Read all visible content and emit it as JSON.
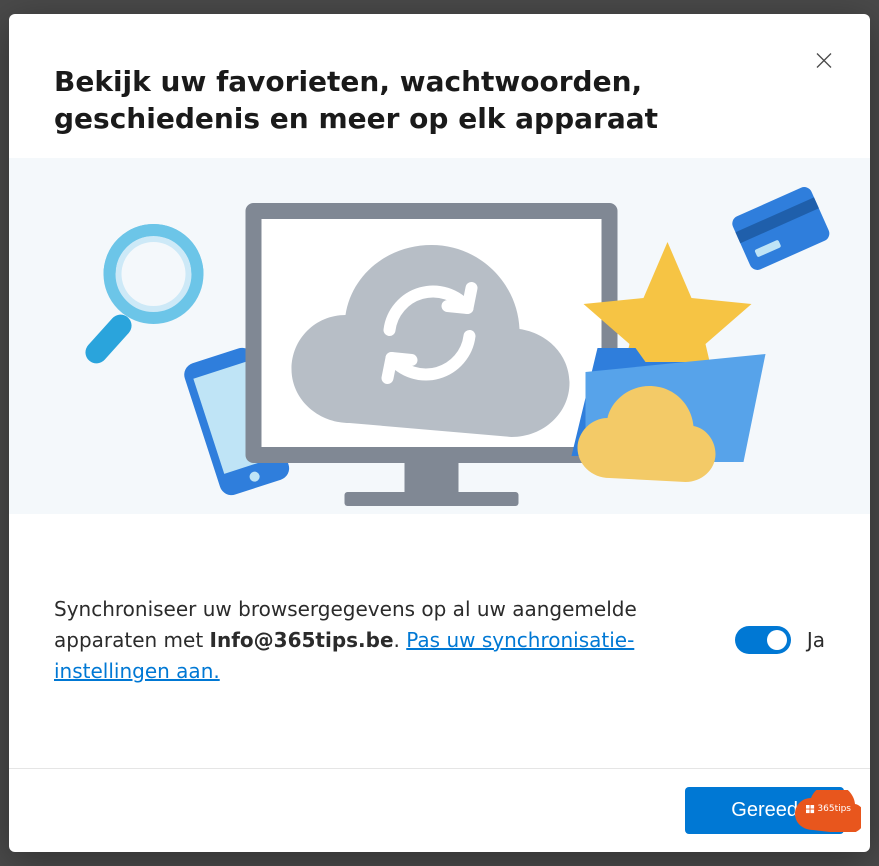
{
  "dialog": {
    "title": "Bekijk uw favorieten, wachtwoorden, geschiedenis en meer op elk apparaat",
    "close_label": "Sluiten"
  },
  "sync": {
    "text_before": "Synchroniseer uw browsergegevens op al uw aangemelde apparaten met ",
    "email": "Info@365tips.be",
    "text_after_email": ". ",
    "link_text": "Pas uw synchronisatie-instellingen aan.",
    "toggle_state": true,
    "toggle_label": "Ja"
  },
  "footer": {
    "primary_button": "Gereed"
  },
  "watermark": {
    "label": "365tips"
  },
  "colors": {
    "accent": "#0078d4",
    "illustration_bg": "#f4f8fb",
    "watermark": "#e8561d"
  }
}
